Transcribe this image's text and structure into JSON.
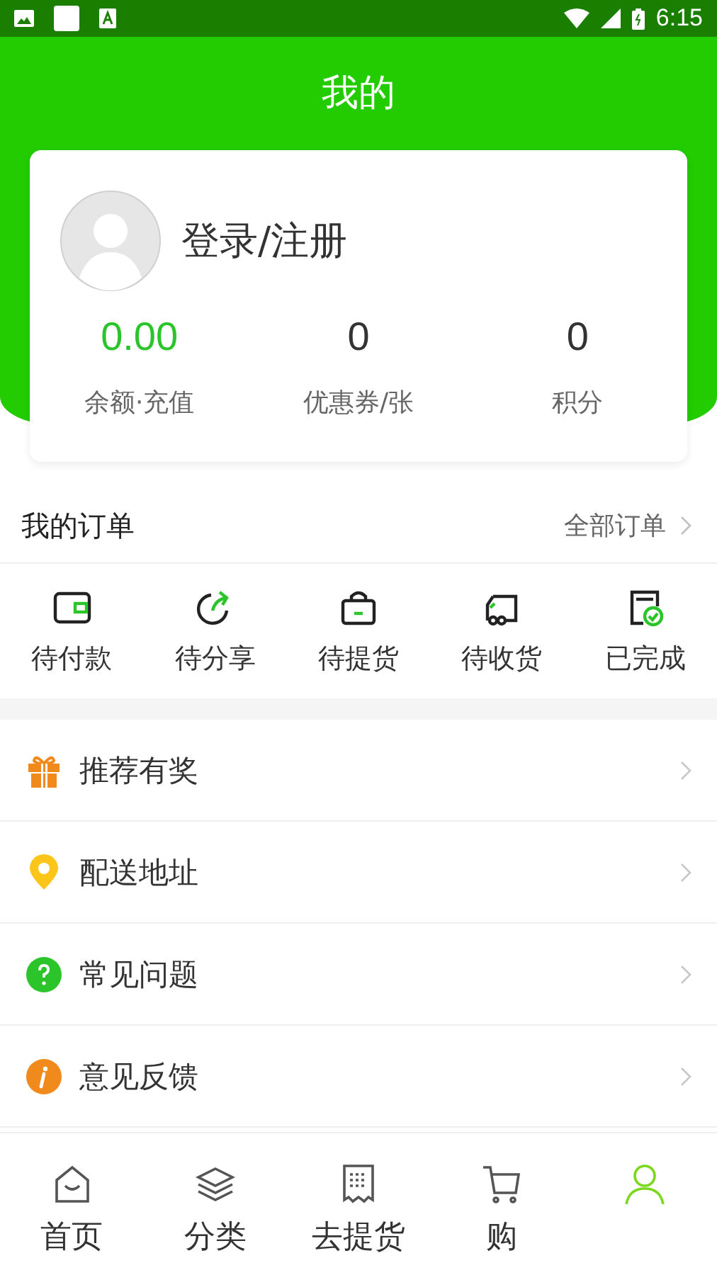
{
  "status_bar": {
    "time": "6:15"
  },
  "header": {
    "title": "我的"
  },
  "profile": {
    "login_label": "登录/注册",
    "stats": [
      {
        "value": "0.00",
        "label": "余额·充值",
        "highlight": true
      },
      {
        "value": "0",
        "label": "优惠券/张",
        "highlight": false
      },
      {
        "value": "0",
        "label": "积分",
        "highlight": false
      }
    ]
  },
  "orders": {
    "title": "我的订单",
    "all_link": "全部订单",
    "items": [
      {
        "label": "待付款"
      },
      {
        "label": "待分享"
      },
      {
        "label": "待提货"
      },
      {
        "label": "待收货"
      },
      {
        "label": "已完成"
      }
    ]
  },
  "menu": [
    {
      "label": "推荐有奖"
    },
    {
      "label": "配送地址"
    },
    {
      "label": "常见问题"
    },
    {
      "label": "意见反馈"
    }
  ],
  "tab_bar": [
    {
      "label": "首页",
      "selected": false
    },
    {
      "label": "分类",
      "selected": false
    },
    {
      "label": "去提货",
      "selected": false
    },
    {
      "label": "购",
      "selected": false
    },
    {
      "selected": true
    }
  ]
}
